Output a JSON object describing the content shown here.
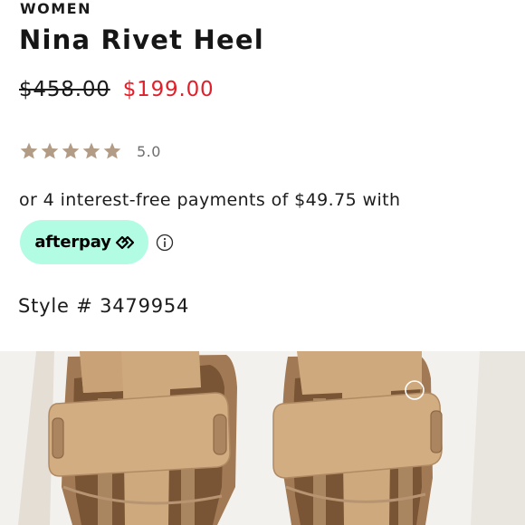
{
  "product": {
    "category": "WOMEN",
    "name": "Nina Rivet Heel",
    "original_price": "$458.00",
    "sale_price": "$199.00",
    "rating": {
      "value": 5.0,
      "display": "5.0",
      "max": 5
    },
    "installment_text": "or 4 interest-free payments of $49.75 with",
    "style_number": "Style # 3479954"
  },
  "afterpay": {
    "label": "afterpay",
    "logo_icon": "afterpay-arrows-icon"
  },
  "icons": {
    "star": "star-icon",
    "info": "info-icon"
  },
  "colors": {
    "sale_price": "#e0202a",
    "star": "#b39c86",
    "afterpay_badge": "#b2fce4",
    "rating_text": "#6e6e6e",
    "suede": "#cfa97e"
  }
}
